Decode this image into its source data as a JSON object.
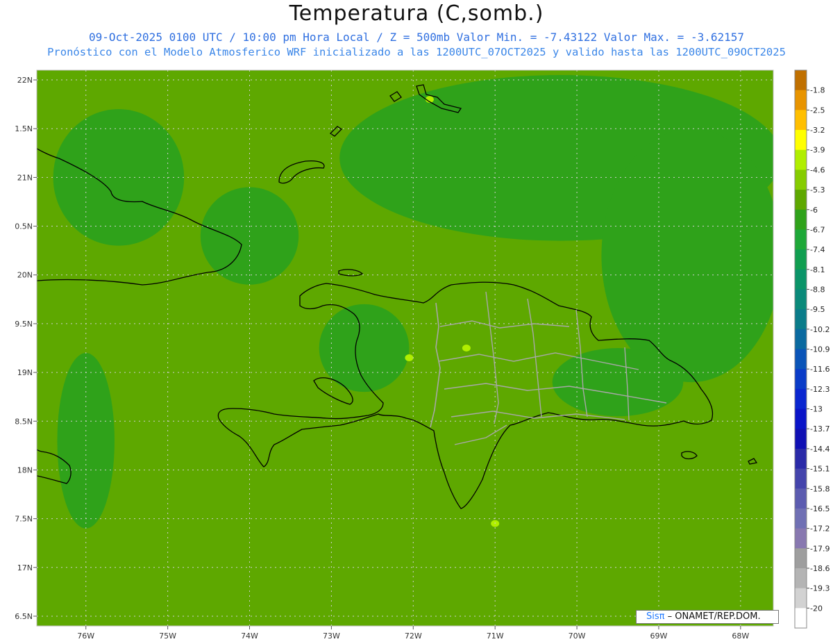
{
  "title": "Temperatura (C,somb.)",
  "subtitle_line1": "09-Oct-2025  0100 UTC / 10:00 pm Hora Local / Z = 500mb  Valor Min. = -7.43122  Valor Max. = -3.62157",
  "subtitle_line2": "Pronóstico con el Modelo Atmosferico WRF inicializado a las 1200UTC_07OCT2025 y valido hasta las  1200UTC_09OCT2025",
  "credit": {
    "logo": "Sisπ",
    "text": " – ONAMET/REP.DOM."
  },
  "colors": {
    "base_field": "#5ea800",
    "cool_patch": "#2fa21a",
    "coast": "#000000",
    "province_border": "#a8a8a8",
    "grid": "#cfcfcf"
  },
  "chart_data": {
    "type": "heatmap",
    "title": "Temperatura (C,somb.)",
    "xlim": [
      -76.6,
      -67.6
    ],
    "ylim": [
      16.4,
      22.1
    ],
    "lon_ticks": [
      {
        "value": -76,
        "label": "76W"
      },
      {
        "value": -75,
        "label": "75W"
      },
      {
        "value": -74,
        "label": "74W"
      },
      {
        "value": -73,
        "label": "73W"
      },
      {
        "value": -72,
        "label": "72W"
      },
      {
        "value": -71,
        "label": "71W"
      },
      {
        "value": -70,
        "label": "70W"
      },
      {
        "value": -69,
        "label": "69W"
      },
      {
        "value": -68,
        "label": "68W"
      }
    ],
    "lat_ticks": [
      {
        "value": 22.0,
        "label": "22N"
      },
      {
        "value": 21.5,
        "label": "1.5N"
      },
      {
        "value": 21.0,
        "label": "21N"
      },
      {
        "value": 20.5,
        "label": "0.5N"
      },
      {
        "value": 20.0,
        "label": "20N"
      },
      {
        "value": 19.5,
        "label": "9.5N"
      },
      {
        "value": 19.0,
        "label": "19N"
      },
      {
        "value": 18.5,
        "label": "8.5N"
      },
      {
        "value": 18.0,
        "label": "18N"
      },
      {
        "value": 17.5,
        "label": "7.5N"
      },
      {
        "value": 17.0,
        "label": "17N"
      },
      {
        "value": 16.5,
        "label": "6.5N"
      }
    ],
    "value_min": -7.43122,
    "value_max": -3.62157,
    "colorbar": [
      {
        "label": "-1.8",
        "color": "#c07000"
      },
      {
        "label": "-2.5",
        "color": "#e89400"
      },
      {
        "label": "-3.2",
        "color": "#ffbf00"
      },
      {
        "label": "-3.9",
        "color": "#ffff00"
      },
      {
        "label": "-4.6",
        "color": "#b0ee00"
      },
      {
        "label": "-5.3",
        "color": "#86cc00"
      },
      {
        "label": "-6",
        "color": "#5ea800"
      },
      {
        "label": "-6.7",
        "color": "#2fa21a"
      },
      {
        "label": "-7.4",
        "color": "#1ea838"
      },
      {
        "label": "-8.1",
        "color": "#109e50"
      },
      {
        "label": "-8.8",
        "color": "#0a9468"
      },
      {
        "label": "-9.5",
        "color": "#0a8a7a"
      },
      {
        "label": "-10.2",
        "color": "#0a7c8a"
      },
      {
        "label": "-10.9",
        "color": "#0a6aa0"
      },
      {
        "label": "-11.6",
        "color": "#0a54b8"
      },
      {
        "label": "-12.3",
        "color": "#0a3cc8"
      },
      {
        "label": "-13",
        "color": "#0a26d0"
      },
      {
        "label": "-13.7",
        "color": "#0a14c8"
      },
      {
        "label": "-14.4",
        "color": "#1010b4"
      },
      {
        "label": "-15.1",
        "color": "#2a2aa8"
      },
      {
        "label": "-15.8",
        "color": "#4444ac"
      },
      {
        "label": "-16.5",
        "color": "#5c5cb0"
      },
      {
        "label": "-17.2",
        "color": "#7070b4"
      },
      {
        "label": "-17.9",
        "color": "#8878b0"
      },
      {
        "label": "-18.6",
        "color": "#9e9e9e"
      },
      {
        "label": "-19.3",
        "color": "#b4b4b4"
      },
      {
        "label": "-20",
        "color": "#d2d2d2"
      },
      {
        "label": "",
        "color": "#ffffff"
      }
    ],
    "cool_regions": [
      {
        "name": "north-atlantic",
        "lon": -70.2,
        "lat": 21.2,
        "rlon": 2.7,
        "rlat": 0.85
      },
      {
        "name": "northeast-atlantic",
        "lon": -68.6,
        "lat": 20.2,
        "rlon": 1.1,
        "rlat": 1.3
      },
      {
        "name": "cuba-west",
        "lon": -75.6,
        "lat": 21.0,
        "rlon": 0.8,
        "rlat": 0.7
      },
      {
        "name": "haiti-center",
        "lon": -72.6,
        "lat": 19.25,
        "rlon": 0.55,
        "rlat": 0.45
      },
      {
        "name": "hispaniola-east",
        "lon": -69.5,
        "lat": 18.9,
        "rlon": 0.8,
        "rlat": 0.35
      },
      {
        "name": "windward-passage",
        "lon": -74.0,
        "lat": 20.4,
        "rlon": 0.6,
        "rlat": 0.5
      },
      {
        "name": "west-caribbean",
        "lon": -76.0,
        "lat": 18.3,
        "rlon": 0.35,
        "rlat": 0.9
      }
    ],
    "warm_spots": [
      {
        "lon": -71.8,
        "lat": 21.8
      },
      {
        "lon": -72.05,
        "lat": 19.15
      },
      {
        "lon": -71.35,
        "lat": 19.25
      },
      {
        "lon": -71.0,
        "lat": 17.45
      }
    ]
  }
}
